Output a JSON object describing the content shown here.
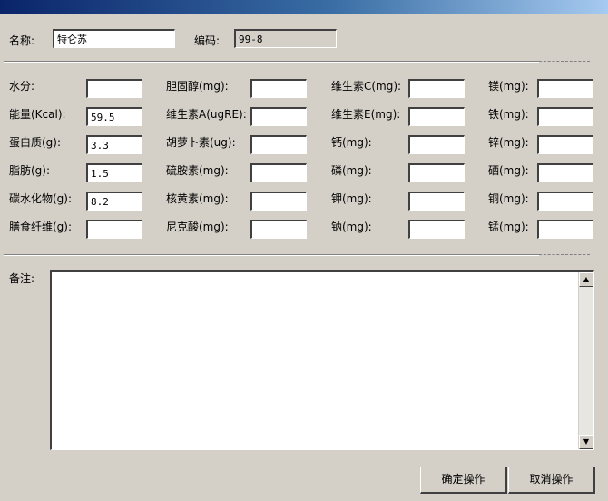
{
  "header": {
    "name_label": "名称:",
    "name_value": "特仑苏",
    "code_label": "编码:",
    "code_value": "99-8"
  },
  "nutrients": {
    "col1": [
      {
        "label": "水分:",
        "value": ""
      },
      {
        "label": "能量(Kcal):",
        "value": "59.5"
      },
      {
        "label": "蛋白质(g):",
        "value": "3.3"
      },
      {
        "label": "脂肪(g):",
        "value": "1.5"
      },
      {
        "label": "碳水化物(g):",
        "value": "8.2"
      },
      {
        "label": "膳食纤维(g):",
        "value": ""
      }
    ],
    "col2": [
      {
        "label": "胆固醇(mg):",
        "value": ""
      },
      {
        "label": "维生素A(ugRE):",
        "value": ""
      },
      {
        "label": "胡萝卜素(ug):",
        "value": ""
      },
      {
        "label": "硫胺素(mg):",
        "value": ""
      },
      {
        "label": "核黄素(mg):",
        "value": ""
      },
      {
        "label": "尼克酸(mg):",
        "value": ""
      }
    ],
    "col3": [
      {
        "label": "维生素C(mg):",
        "value": ""
      },
      {
        "label": "维生素E(mg):",
        "value": ""
      },
      {
        "label": "钙(mg):",
        "value": ""
      },
      {
        "label": "磷(mg):",
        "value": ""
      },
      {
        "label": "钾(mg):",
        "value": ""
      },
      {
        "label": "钠(mg):",
        "value": ""
      }
    ],
    "col4": [
      {
        "label": "镁(mg):",
        "value": ""
      },
      {
        "label": "铁(mg):",
        "value": ""
      },
      {
        "label": "锌(mg):",
        "value": ""
      },
      {
        "label": "硒(mg):",
        "value": ""
      },
      {
        "label": "铜(mg):",
        "value": ""
      },
      {
        "label": "锰(mg):",
        "value": ""
      }
    ]
  },
  "memo": {
    "label": "备注:",
    "value": ""
  },
  "buttons": {
    "confirm": "确定操作",
    "cancel": "取消操作"
  },
  "icons": {
    "scroll_up": "arrow-up-icon",
    "scroll_down": "arrow-down-icon"
  },
  "colors": {
    "dialog_bg": "#d4d0c8",
    "titlebar_start": "#0a246a",
    "titlebar_end": "#a6caf0"
  }
}
